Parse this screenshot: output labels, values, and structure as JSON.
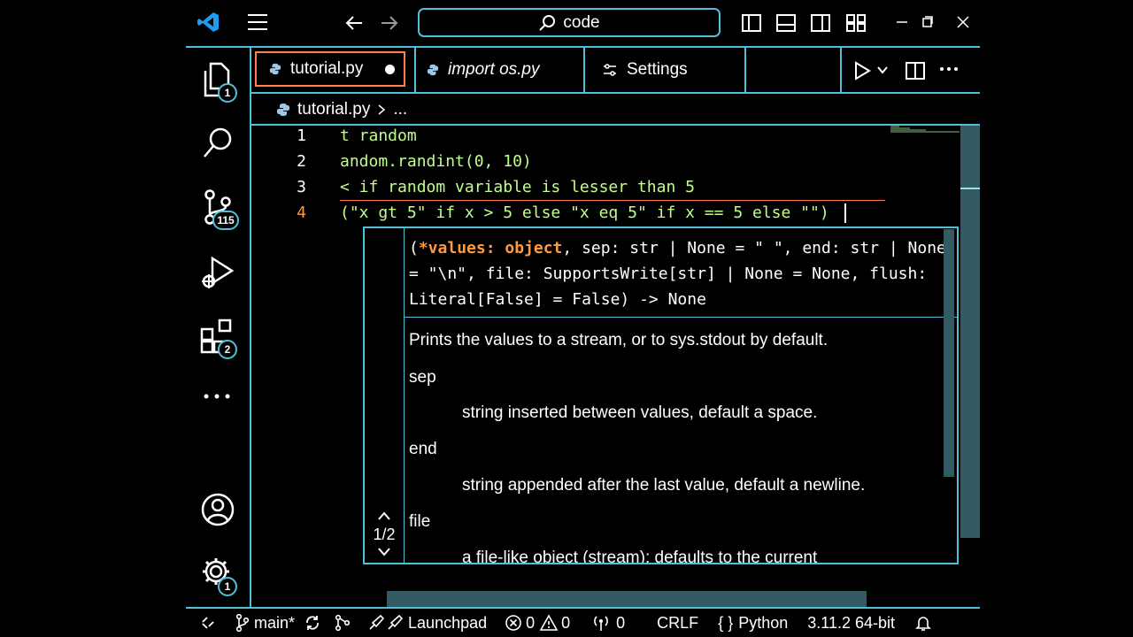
{
  "title_bar": {
    "search_text": "code",
    "window_controls": [
      "minimize-icon",
      "restore-icon",
      "close-icon"
    ]
  },
  "activity_bar": {
    "explorer_badge": "1",
    "source_control_badge": "115",
    "extensions_badge": "2",
    "settings_badge": "1"
  },
  "tabs": [
    {
      "label": "tutorial.py",
      "active": true,
      "dirty": true
    },
    {
      "label": "import os.py",
      "active": false
    },
    {
      "label": "Settings",
      "active": false
    }
  ],
  "breadcrumb": {
    "file": "tutorial.py",
    "rest": "..."
  },
  "editor": {
    "line_numbers": [
      "1",
      "2",
      "3",
      "4"
    ],
    "lines": [
      "t random",
      "andom.randint(0, 10)",
      "< if random variable is lesser than 5",
      "(\"x gt 5\" if x > 5 else \"x eq 5\" if x == 5 else \"\")"
    ]
  },
  "hover": {
    "signature_bold": "*values: object",
    "signature_rest": ", sep: str | None = \" \", end: str | None = \"\\n\", file: SupportsWrite[str] | None = None, flush: Literal[False] = False) -> None",
    "signature_open": "(",
    "description": "Prints the values to a stream, or to sys.stdout by default.",
    "params": [
      {
        "name": "sep",
        "desc": "string inserted between values, default a space."
      },
      {
        "name": "end",
        "desc": "string appended after the last value, default a newline."
      },
      {
        "name": "file",
        "desc": "a file-like object (stream); defaults to the current"
      }
    ],
    "overload": "1/2"
  },
  "status_bar": {
    "branch": "main*",
    "launchpad": "Launchpad",
    "errors": "0",
    "warnings": "0",
    "ports": "0",
    "eol": "CRLF",
    "language": "Python",
    "interpreter": "3.11.2 64-bit"
  },
  "colors": {
    "accent": "#4ec1d8",
    "active_tab_border": "#ff7f50",
    "code_green": "#c0ff8a",
    "variable": "#89ddff",
    "param_highlight": "#ff9a40",
    "scrollbar": "#345a63"
  }
}
